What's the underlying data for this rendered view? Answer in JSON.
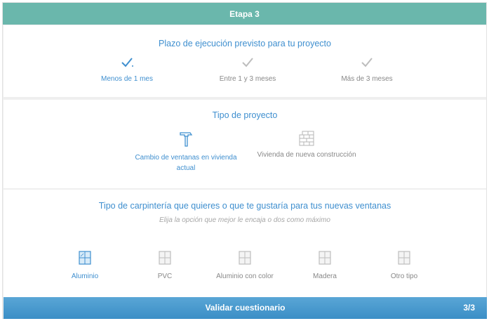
{
  "header": {
    "title": "Etapa 3"
  },
  "plazo": {
    "title": "Plazo de ejecución previsto para tu proyecto",
    "options": [
      {
        "label": "Menos de 1 mes",
        "icon": "check-icon"
      },
      {
        "label": "Entre 1 y 3 meses",
        "icon": "check-icon"
      },
      {
        "label": "Más de 3 meses",
        "icon": "check-icon"
      }
    ]
  },
  "tipo": {
    "title": "Tipo de proyecto",
    "options": [
      {
        "label": "Cambio de ventanas en vivienda actual",
        "icon": "hammer-icon"
      },
      {
        "label": "Vivienda de nueva construcción",
        "icon": "brick-wall-icon"
      }
    ]
  },
  "carpinteria": {
    "title": "Tipo de carpintería que quieres o que te gustaría para tus nuevas ventanas",
    "subtitle": "Elija la opción que mejor le encaja o dos como máximo",
    "options": [
      {
        "label": "Aluminio",
        "icon": "window-icon"
      },
      {
        "label": "PVC",
        "icon": "window-icon"
      },
      {
        "label": "Aluminio con color",
        "icon": "window-icon"
      },
      {
        "label": "Madera",
        "icon": "window-icon"
      },
      {
        "label": "Otro tipo",
        "icon": "window-icon"
      }
    ]
  },
  "footer": {
    "validate_label": "Validar cuestionario",
    "page": "3/3"
  },
  "colors": {
    "header": "#6ab7ac",
    "accent": "#3f8fcf",
    "muted": "#888888",
    "footer": "#4a9bd0"
  }
}
